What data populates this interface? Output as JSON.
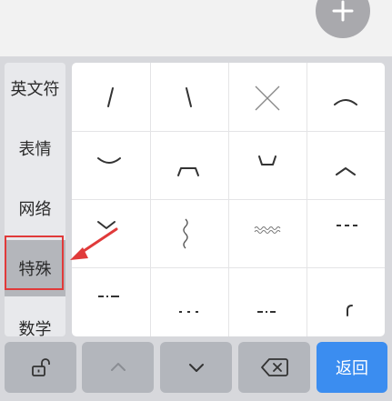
{
  "categories": [
    {
      "label": "英文符",
      "selected": false
    },
    {
      "label": "表情",
      "selected": false
    },
    {
      "label": "网络",
      "selected": false
    },
    {
      "label": "特殊",
      "selected": true
    },
    {
      "label": "数学",
      "selected": false
    }
  ],
  "symbols": [
    "slash",
    "backslash",
    "x-cross",
    "arc-up",
    "smile-curve",
    "mouth-bracket",
    "cup-bracket",
    "caret",
    "chevron-down",
    "wavy-vertical",
    "wavy-horizontal",
    "dashed-line",
    "dash-dot",
    "dotted-line",
    "dash-dot-dot",
    "corner-arc"
  ],
  "bottom_bar": {
    "lock_icon": "unlock-icon",
    "up_icon": "chevron-up-icon",
    "down_icon": "chevron-down-icon",
    "delete_icon": "backspace-icon",
    "return_label": "返回"
  },
  "fab_icon": "plus-icon",
  "colors": {
    "selected_category": "#b4b6bb",
    "return_button": "#3b8df0",
    "annotation": "#e03a3a"
  }
}
